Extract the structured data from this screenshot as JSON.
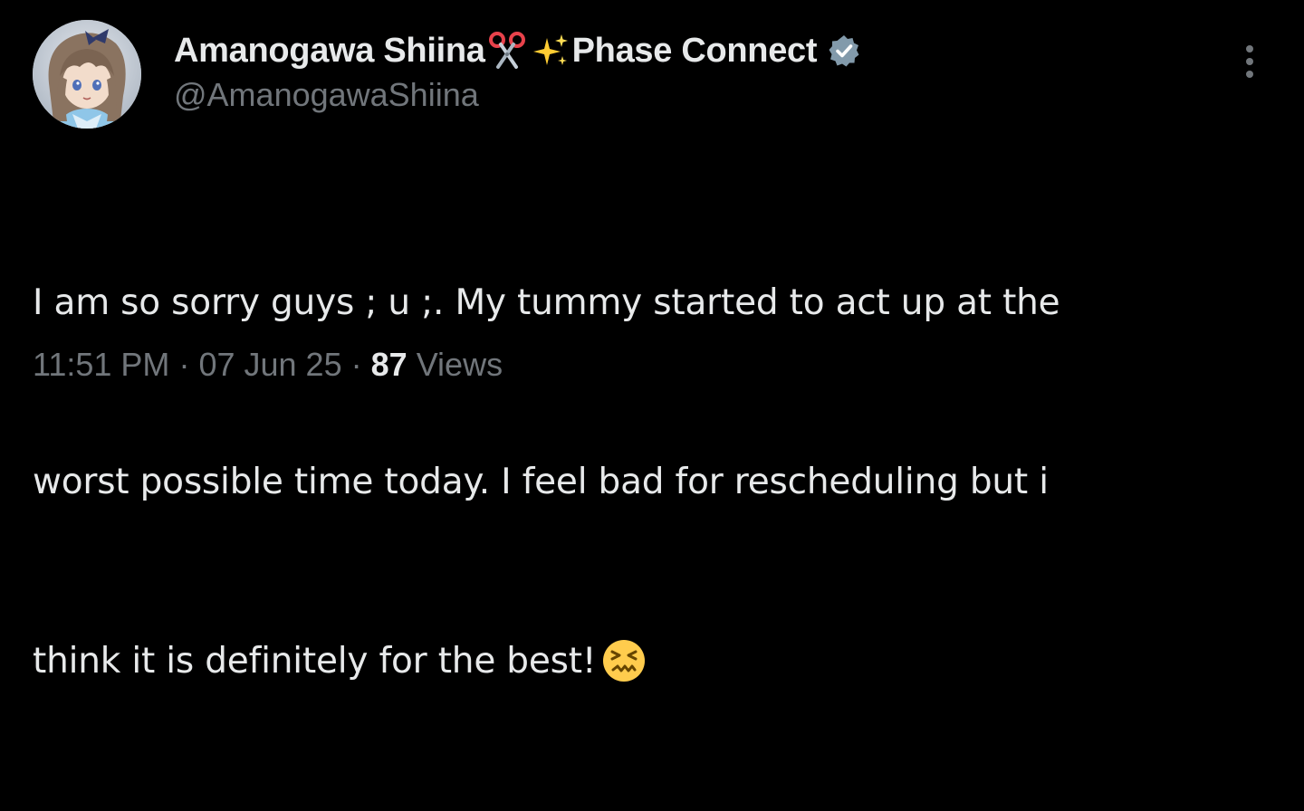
{
  "author": {
    "display_name_part1": "Amanogawa Shiina",
    "name_emoji_1": "scissors-emoji",
    "name_emoji_2": "sparkles-emoji",
    "display_name_part2": "Phase Connect",
    "handle": "@AmanogawaShiina",
    "verified_badge": "verified-check-icon",
    "verified_color": "#829aab",
    "avatar": "avatar-image"
  },
  "post": {
    "text_lines": [
      "I am so sorry guys ; u ;. My tummy started to act up at the",
      "worst possible time today. I feel bad for rescheduling but i",
      "think it is definitely for the best!"
    ],
    "trailing_emoji": "confounded-face-emoji"
  },
  "meta": {
    "time": "11:51 PM",
    "separator": "·",
    "date": "07 Jun 25",
    "views_count": "87",
    "views_label": "Views"
  },
  "menu": {
    "more_icon": "more-vertical-icon"
  },
  "colors": {
    "background": "#000000",
    "primary_text": "#e7e9ea",
    "secondary_text": "#71767b"
  }
}
